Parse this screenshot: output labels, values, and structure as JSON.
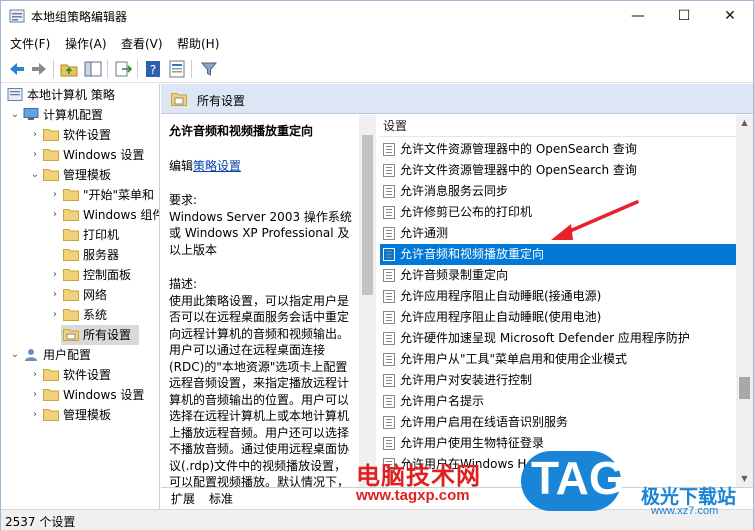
{
  "window": {
    "title": "本地组策略编辑器",
    "minimize": "—",
    "maximize": "☐",
    "close": "✕"
  },
  "menu": [
    "文件(F)",
    "操作(A)",
    "查看(V)",
    "帮助(H)"
  ],
  "tree": {
    "root": "本地计算机 策略",
    "computer_config": "计算机配置",
    "software_settings": "软件设置",
    "windows_settings": "Windows 设置",
    "admin_templates": "管理模板",
    "start_menu": "\"开始\"菜单和",
    "windows_components": "Windows 组件",
    "printers": "打印机",
    "servers": "服务器",
    "control_panel": "控制面板",
    "network": "网络",
    "system": "系统",
    "all_settings": "所有设置",
    "user_config": "用户配置",
    "user_software_settings": "软件设置",
    "user_windows_settings": "Windows 设置",
    "user_admin_templates": "管理模板"
  },
  "right_header": "所有设置",
  "description": {
    "title": "允许音频和视频播放重定向",
    "edit_prefix": "编辑",
    "edit_link": "策略设置",
    "req_label": "要求:",
    "req_text": "Windows Server 2003 操作系统或 Windows XP Professional 及以上版本",
    "desc_label": "描述:",
    "desc_text": "使用此策略设置，可以指定用户是否可以在远程桌面服务会话中重定向远程计算机的音频和视频输出。用户可以通过在远程桌面连接(RDC)的\"本地资源\"选项卡上配置远程音频设置，来指定播放远程计算机的音频输出的位置。用户可以选择在远程计算机上或本地计算机上播放远程音频。用户还可以选择不播放音频。通过使用远程桌面协议(.rdp)文件中的视频播放设置，可以配置视频播放。默认情况下，"
  },
  "list": {
    "column": "设置",
    "rows": [
      "允许文件资源管理器中的 OpenSearch 查询",
      "允许文件资源管理器中的 OpenSearch 查询",
      "允许消息服务云同步",
      "允许修剪已公布的打印机",
      "允许通测",
      "允许音频和视频播放重定向",
      "允许音频录制重定向",
      "允许应用程序阻止自动睡眠(接通电源)",
      "允许应用程序阻止自动睡眠(使用电池)",
      "允许硬件加速呈现 Microsoft Defender 应用程序防护",
      "允许用户从\"工具\"菜单启用和使用企业模式",
      "允许用户对安装进行控制",
      "允许用户名提示",
      "允许用户启用在线语音识别服务",
      "允许用户使用生物特征登录",
      "允许用户在Windows Hello 上注册"
    ],
    "highlighted_index": 5
  },
  "tabs": [
    "扩展",
    "标准"
  ],
  "status": "2537 个设置",
  "watermark": {
    "cn": "电脑技术网",
    "url": "www.tagxp.com",
    "tag": "TAG",
    "site_cn": "极光下载站",
    "site_url": "www.xz7.com"
  },
  "colors": {
    "accent": "#0078d7",
    "header_bg": "#dce6f4",
    "arrow": "#e8222a"
  }
}
